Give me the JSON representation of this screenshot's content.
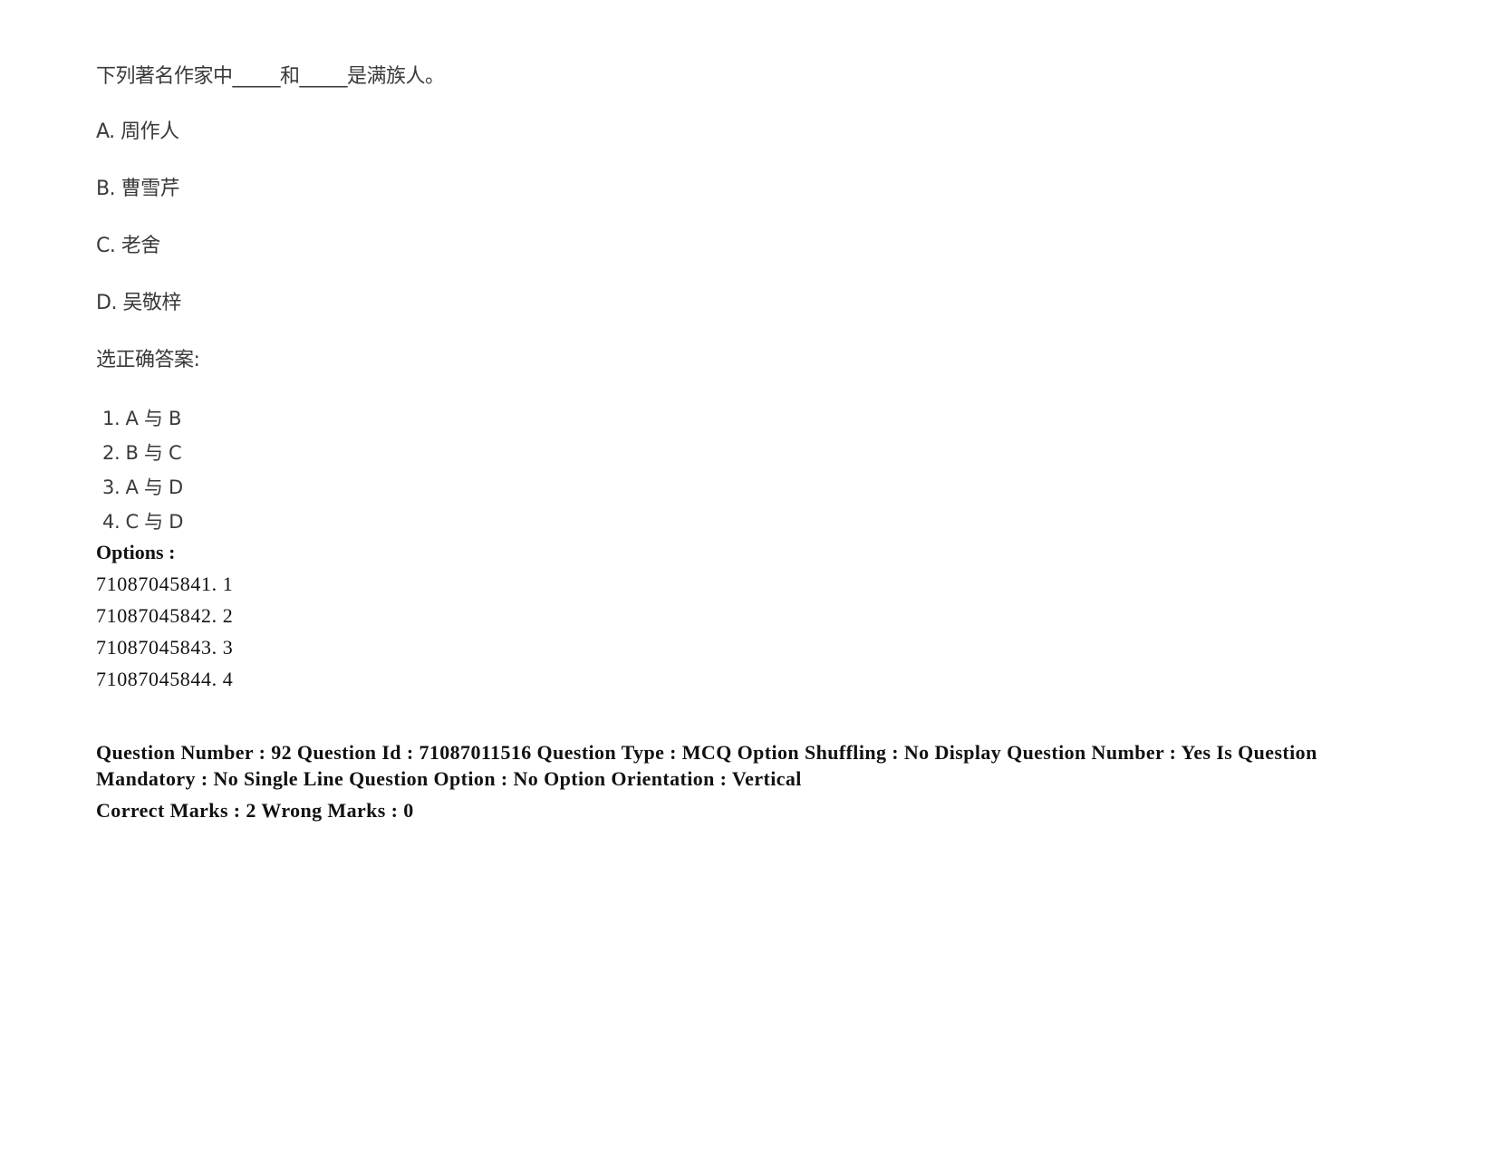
{
  "question": {
    "stem": "下列著名作家中_____和_____是满族人。",
    "options": [
      {
        "label": "A. 周作人"
      },
      {
        "label": "B. 曹雪芹"
      },
      {
        "label": "C. 老舍"
      },
      {
        "label": "D. 吴敬梓"
      }
    ],
    "prompt": "选正确答案:",
    "choices": [
      {
        "num": "1.",
        "text": "A 与 B"
      },
      {
        "num": "2.",
        "text": "B 与 C"
      },
      {
        "num": "3.",
        "text": "A 与 D"
      },
      {
        "num": "4.",
        "text": "C 与 D"
      }
    ]
  },
  "options_block": {
    "label": "Options :",
    "items": [
      "71087045841. 1",
      "71087045842. 2",
      "71087045843. 3",
      "71087045844. 4"
    ]
  },
  "meta": {
    "details": "Question Number : 92 Question Id : 71087011516 Question Type : MCQ Option Shuffling : No Display Question Number : Yes Is Question Mandatory : No Single Line Question Option : No Option Orientation : Vertical",
    "marks": "Correct Marks : 2 Wrong Marks : 0"
  }
}
